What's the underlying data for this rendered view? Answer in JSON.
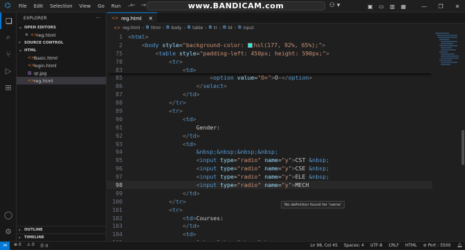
{
  "window": {
    "menu": [
      "File",
      "Edit",
      "Selection",
      "View",
      "Go",
      "Run",
      "···"
    ],
    "search_text": "www.BANDICAM.com",
    "nav_back": "←",
    "nav_fwd": "→"
  },
  "sidebar": {
    "title": "EXPLORER",
    "more": "···",
    "open_editors_label": "OPEN EDITORS",
    "open_editor_file": "reg.html",
    "source_control_label": "SOURCE CONTROL",
    "folder_label": "HTML",
    "files": [
      "Basic.html",
      "login.html",
      "qr.jpg",
      "reg.html"
    ],
    "outline_label": "OUTLINE",
    "timeline_label": "TIMELINE"
  },
  "editor": {
    "tab_label": "reg.html",
    "breadcrumbs": [
      "reg.html",
      "html",
      "body",
      "table",
      "tr",
      "td",
      "input"
    ],
    "tooltip": "No definition found for 'name'"
  },
  "code_lines": [
    {
      "n": "1"
    },
    {
      "n": "2"
    },
    {
      "n": "75"
    },
    {
      "n": "78"
    },
    {
      "n": "83"
    },
    {
      "n": "85"
    },
    {
      "n": "86"
    },
    {
      "n": "87"
    },
    {
      "n": "88"
    },
    {
      "n": "89"
    },
    {
      "n": "90"
    },
    {
      "n": "91"
    },
    {
      "n": "92"
    },
    {
      "n": "93"
    },
    {
      "n": "94"
    },
    {
      "n": "95"
    },
    {
      "n": "96"
    },
    {
      "n": "97"
    },
    {
      "n": "98"
    },
    {
      "n": "99"
    },
    {
      "n": "100"
    },
    {
      "n": "101"
    },
    {
      "n": "102"
    },
    {
      "n": "103"
    },
    {
      "n": "104"
    },
    {
      "n": "105"
    }
  ],
  "code_text": {
    "l1_tag": "html",
    "l2_tag": "body",
    "l2_attr": "style",
    "l2_str": "\"background-color: ",
    "l2_str2": "hsl(177, 92%, 65%);\"",
    "l75_tag": "table",
    "l75_attr": "style",
    "l75_str": "\"padding-left: 450px; height: 590px;\"",
    "tr": "tr",
    "td": "td",
    "option": "option",
    "value": "value",
    "o_plus_str": "\"O+\"",
    "o_minus_text": "O-",
    "select": "select",
    "gender": "Gender:",
    "nbsp4": "&nbsp;&nbsp;&nbsp;&nbsp;",
    "input": "input",
    "type": "type",
    "radio_str": "\"radio\"",
    "name": "name",
    "y_str": "\"y\"",
    "cst": "CST",
    "cse": "CSE",
    "ele": "ELE",
    "mech": "MECH",
    "nbsp1": "&nbsp;",
    "courses": "Courses:"
  },
  "statusbar": {
    "errors": "⊗ 0",
    "warnings": "⚠ 0",
    "info": "⓪ 0",
    "position": "Ln 98, Col 45",
    "spaces": "Spaces: 4",
    "encoding": "UTF-8",
    "eol": "CRLF",
    "language": "HTML",
    "port": "⊘ Port : 5500"
  },
  "colors": {
    "accent": "#0078d4",
    "swatch": "#1ff0dc"
  }
}
